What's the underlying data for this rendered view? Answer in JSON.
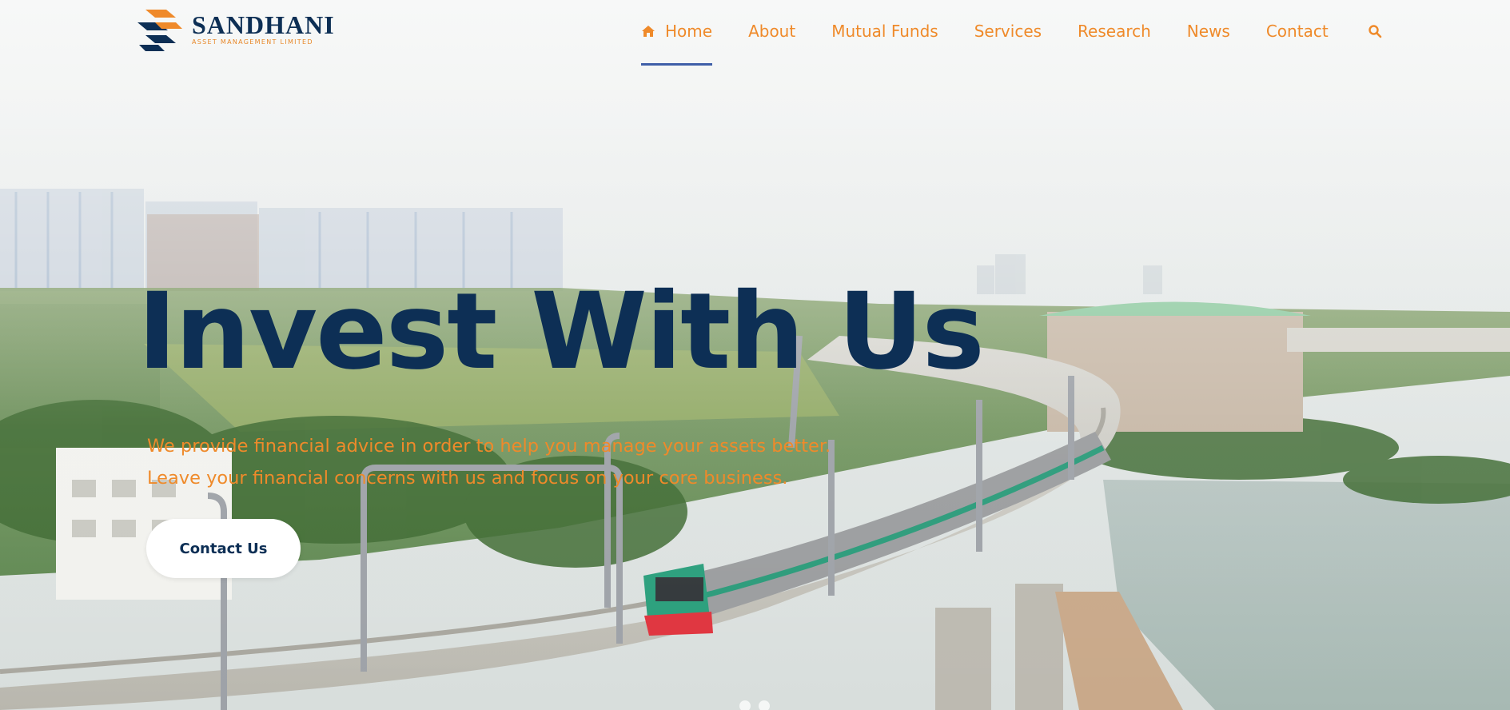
{
  "brand": {
    "name": "SANDHANI",
    "subtitle": "ASSET MANAGEMENT LIMITED"
  },
  "nav": {
    "items": [
      {
        "label": "Home",
        "active": true,
        "icon": "home-icon"
      },
      {
        "label": "About"
      },
      {
        "label": "Mutual Funds"
      },
      {
        "label": "Services"
      },
      {
        "label": "Research"
      },
      {
        "label": "News"
      },
      {
        "label": "Contact"
      }
    ],
    "search_icon": "search-icon"
  },
  "hero": {
    "title": "Invest With Us",
    "description_line1": "We provide financial advice in order to help you manage your assets better.",
    "description_line2": "Leave your financial concerns with us and focus on your core business.",
    "cta_label": "Contact Us"
  },
  "colors": {
    "brand_navy": "#0d2f55",
    "accent_orange": "#ef8a2a",
    "active_underline": "#3f5fa8",
    "button_bg": "#ffffff"
  }
}
